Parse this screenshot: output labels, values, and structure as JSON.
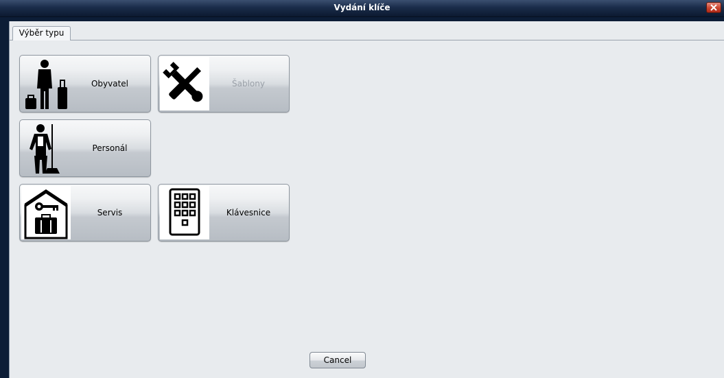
{
  "window": {
    "title": "Vydání klíče"
  },
  "tabs": [
    {
      "label": "Výběr typu"
    }
  ],
  "buttons": {
    "resident": {
      "label": "Obyvatel",
      "icon": "traveler-luggage-icon"
    },
    "templates": {
      "label": "Šablony",
      "icon": "wrench-screwdriver-icon",
      "enabled": false
    },
    "staff": {
      "label": "Personál",
      "icon": "cleaning-staff-icon"
    },
    "service": {
      "label": "Servis",
      "icon": "house-key-toolbox-icon"
    },
    "keypad": {
      "label": "Klávesnice",
      "icon": "keypad-icon"
    }
  },
  "footer": {
    "cancel_label": "Cancel"
  }
}
